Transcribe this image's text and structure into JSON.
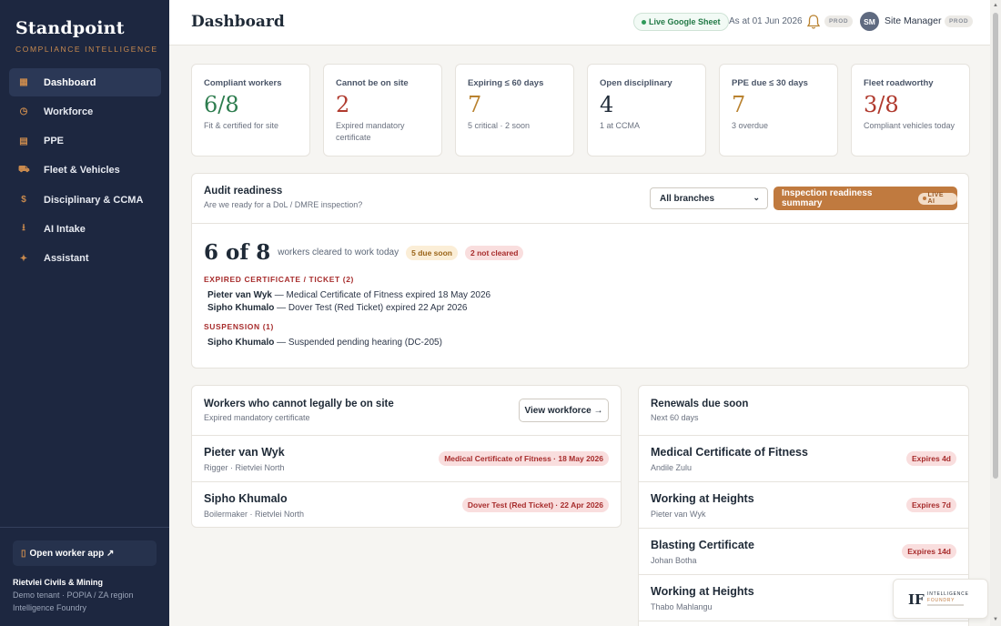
{
  "brand": {
    "name": "Standpoint",
    "tagline": "COMPLIANCE INTELLIGENCE"
  },
  "nav": [
    {
      "label": "Dashboard",
      "icon": "grid-icon",
      "glyph": "▦",
      "active": true
    },
    {
      "label": "Workforce",
      "icon": "clock-icon",
      "glyph": "◷"
    },
    {
      "label": "PPE",
      "icon": "list-icon",
      "glyph": "▤"
    },
    {
      "label": "Fleet & Vehicles",
      "icon": "truck-icon",
      "glyph": "⛟"
    },
    {
      "label": "Disciplinary & CCMA",
      "icon": "dollar-icon",
      "glyph": "$"
    },
    {
      "label": "AI Intake",
      "icon": "download-icon",
      "glyph": "⭳"
    },
    {
      "label": "Assistant",
      "icon": "sparkle-icon",
      "glyph": "✦"
    }
  ],
  "sidebar_footer": {
    "worker_app": "Open worker app ↗",
    "tenant_name": "Rietvlei Civils & Mining",
    "tenant_meta": "Demo tenant · POPIA / ZA region",
    "company": "Intelligence Foundry"
  },
  "header": {
    "title": "Dashboard",
    "live_sheet": "Live Google Sheet",
    "as_at": "As at 01 Jun 2026",
    "env_badge": "PROD",
    "avatar_initials": "SM",
    "user_name": "Site Manager",
    "user_badge": "PROD"
  },
  "kpis": [
    {
      "label": "Compliant workers",
      "value": "6/8",
      "sub": "Fit & certified for site",
      "color": "#2e7d4f"
    },
    {
      "label": "Cannot be on site",
      "value": "2",
      "sub": "Expired mandatory certificate",
      "color": "#b03a2e"
    },
    {
      "label": "Expiring ≤ 60 days",
      "value": "7",
      "sub": "5 critical · 2 soon",
      "color": "#b9822f"
    },
    {
      "label": "Open disciplinary",
      "value": "4",
      "sub": "1 at CCMA",
      "color": "#1f2a37"
    },
    {
      "label": "PPE due ≤ 30 days",
      "value": "7",
      "sub": "3 overdue",
      "color": "#b9822f"
    },
    {
      "label": "Fleet roadworthy",
      "value": "3/8",
      "sub": "Compliant vehicles today",
      "color": "#b03a2e"
    }
  ],
  "audit": {
    "title": "Audit readiness",
    "subtitle": "Are we ready for a DoL / DMRE inspection?",
    "branch_select": "All branches",
    "inspect_button": "Inspection readiness summary",
    "live_ai": "LIVE AI",
    "cleared_count": "6 of 8",
    "cleared_text": "workers cleared to work today",
    "chip_soon": "5 due soon",
    "chip_not": "2 not cleared",
    "groups": [
      {
        "title": "EXPIRED CERTIFICATE / TICKET (2)",
        "items": [
          {
            "name": "Pieter van Wyk",
            "detail": " — Medical Certificate of Fitness expired 18 May 2026"
          },
          {
            "name": "Sipho Khumalo",
            "detail": " — Dover Test (Red Ticket) expired 22 Apr 2026"
          }
        ]
      },
      {
        "title": "SUSPENSION (1)",
        "items": [
          {
            "name": "Sipho Khumalo",
            "detail": " — Suspended pending hearing (DC-205)"
          }
        ]
      }
    ]
  },
  "cannot_panel": {
    "title": "Workers who cannot legally be on site",
    "subtitle": "Expired mandatory certificate",
    "button": "View workforce →",
    "rows": [
      {
        "name": "Pieter van Wyk",
        "meta": "Rigger · Rietvlei North",
        "tag": "Medical Certificate of Fitness · 18 May 2026"
      },
      {
        "name": "Sipho Khumalo",
        "meta": "Boilermaker · Rietvlei North",
        "tag": "Dover Test (Red Ticket) · 22 Apr 2026"
      }
    ]
  },
  "renewals_panel": {
    "title": "Renewals due soon",
    "subtitle": "Next 60 days",
    "rows": [
      {
        "name": "Medical Certificate of Fitness",
        "meta": "Andile Zulu",
        "tag": "Expires 4d"
      },
      {
        "name": "Working at Heights",
        "meta": "Pieter van Wyk",
        "tag": "Expires 7d"
      },
      {
        "name": "Blasting Certificate",
        "meta": "Johan Botha",
        "tag": "Expires 14d"
      },
      {
        "name": "Working at Heights",
        "meta": "Thabo Mahlangu",
        "tag": ""
      }
    ]
  },
  "float_logo": {
    "mark": "IF",
    "line1": "INTELLIGENCE",
    "line2": "FOUNDRY"
  }
}
